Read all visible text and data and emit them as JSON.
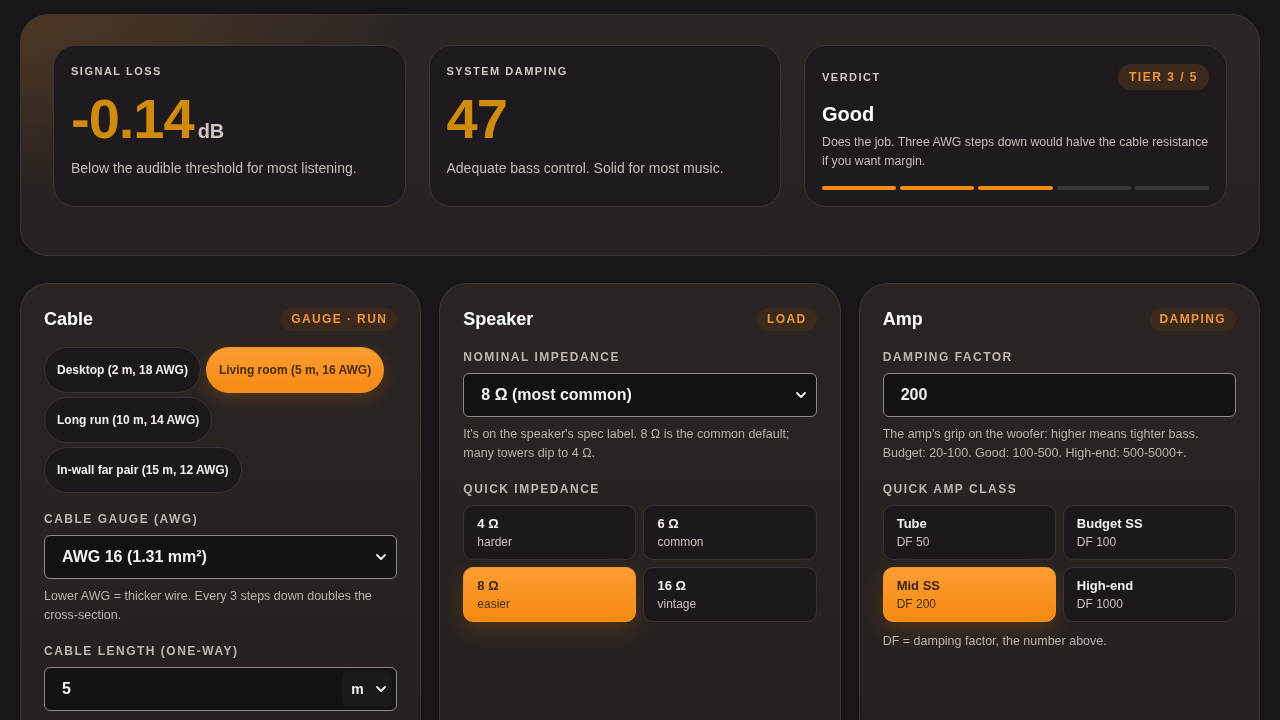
{
  "summary": {
    "stats": [
      {
        "label": "SIGNAL LOSS",
        "value": "-0.14",
        "unit": "dB",
        "description": "Below the audible threshold for most listening."
      },
      {
        "label": "SYSTEM DAMPING",
        "value": "47",
        "description": "Adequate bass control. Solid for most music."
      }
    ],
    "verdict": {
      "label": "VERDICT",
      "badge": "TIER 3 / 5",
      "title": "Good",
      "description": "Does the job. Three AWG steps down would halve the cable resistance if you want margin.",
      "segments": [
        {
          "filled": true
        },
        {
          "filled": true
        },
        {
          "filled": true
        },
        {
          "filled": false
        },
        {
          "filled": false
        }
      ]
    }
  },
  "panels": [
    {
      "title": "Cable",
      "badge": "GAUGE · RUN",
      "sections": [
        {
          "kind": "chips",
          "items": [
            {
              "label": "Desktop (2 m, 18 AWG)",
              "selected": false
            },
            {
              "label": "Living room (5 m, 16 AWG)",
              "selected": true
            },
            {
              "label": "Long run (10 m, 14 AWG)",
              "selected": false
            },
            {
              "label": "In-wall far pair (15 m, 12 AWG)",
              "selected": false
            }
          ]
        },
        {
          "kind": "select",
          "label": "CABLE GAUGE (AWG)",
          "value": "AWG 16 (1.31 mm²)",
          "hint": "Lower AWG = thicker wire. Every 3 steps down doubles the cross-section."
        },
        {
          "kind": "length",
          "label": "CABLE LENGTH (ONE-WAY)",
          "value": "5",
          "unit": "m"
        }
      ]
    },
    {
      "title": "Speaker",
      "badge": "LOAD",
      "sections": [
        {
          "kind": "select",
          "label": "NOMINAL IMPEDANCE",
          "value": "8 Ω (most common)",
          "hint": "It's on the speaker's spec label. 8 Ω is the common default; many towers dip to 4 Ω."
        },
        {
          "kind": "tiles",
          "label": "QUICK IMPEDANCE",
          "items": [
            {
              "value": "4 Ω",
              "note": "harder",
              "selected": false
            },
            {
              "value": "6 Ω",
              "note": "common",
              "selected": false
            },
            {
              "value": "8 Ω",
              "note": "easier",
              "selected": true
            },
            {
              "value": "16 Ω",
              "note": "vintage",
              "selected": false
            }
          ]
        }
      ]
    },
    {
      "title": "Amp",
      "badge": "DAMPING",
      "sections": [
        {
          "kind": "input",
          "label": "DAMPING FACTOR",
          "value": "200",
          "hint": "The amp's grip on the woofer: higher means tighter bass. Budget: 20-100. Good: 100-500. High-end: 500-5000+."
        },
        {
          "kind": "tiles",
          "label": "QUICK AMP CLASS",
          "items": [
            {
              "value": "Tube",
              "note": "DF 50",
              "selected": false
            },
            {
              "value": "Budget SS",
              "note": "DF 100",
              "selected": false
            },
            {
              "value": "Mid SS",
              "note": "DF 200",
              "selected": true
            },
            {
              "value": "High-end",
              "note": "DF 1000",
              "selected": false
            }
          ]
        },
        {
          "kind": "note",
          "text": "DF = damping factor, the number above."
        }
      ]
    }
  ]
}
